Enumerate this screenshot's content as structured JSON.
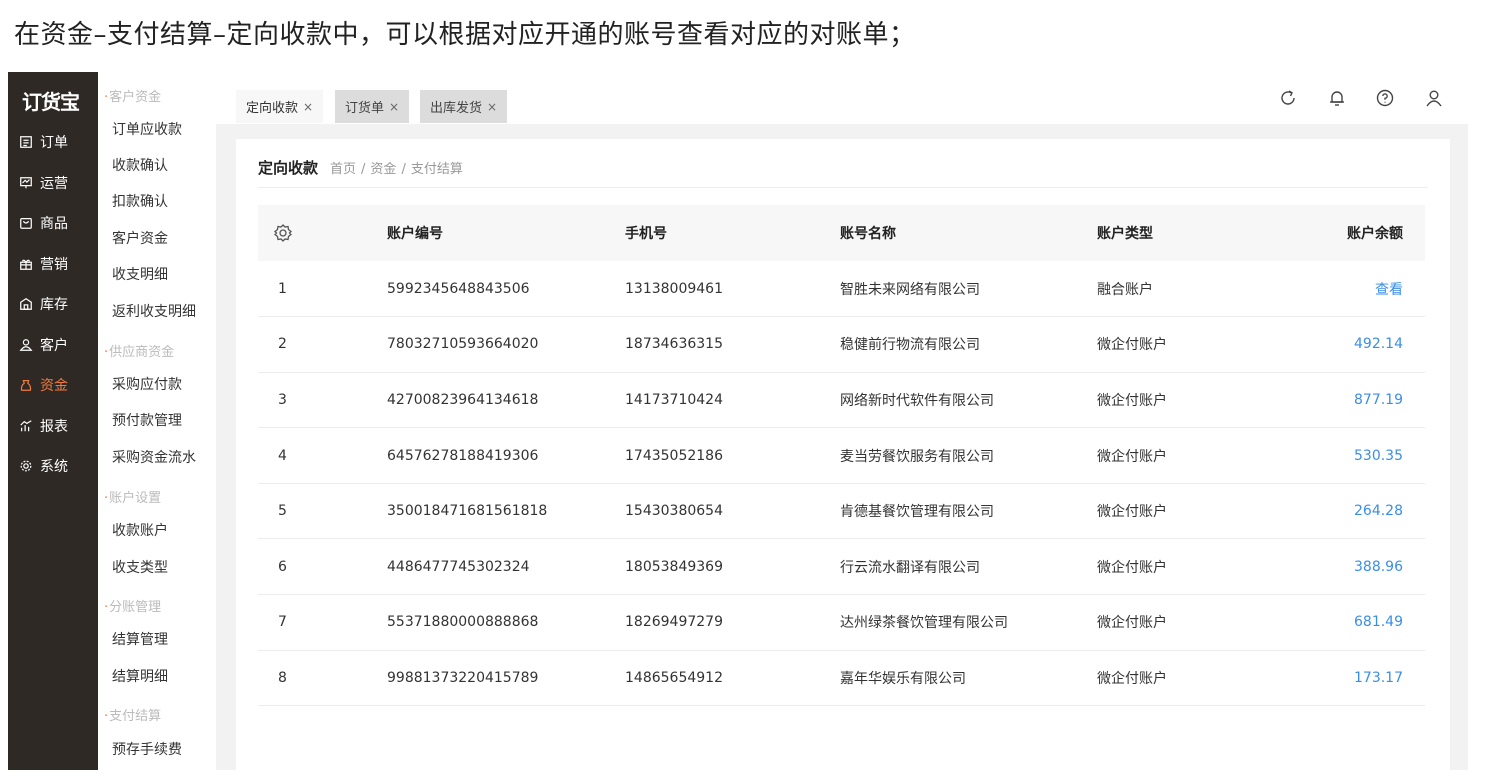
{
  "caption": "在资金–支付结算–定向收款中，可以根据对应开通的账号查看对应的对账单；",
  "logo": "订货宝",
  "nav": [
    {
      "label": "订单",
      "icon": "list-icon"
    },
    {
      "label": "运营",
      "icon": "chart-board-icon"
    },
    {
      "label": "商品",
      "icon": "bag-icon"
    },
    {
      "label": "营销",
      "icon": "gift-icon"
    },
    {
      "label": "库存",
      "icon": "warehouse-icon"
    },
    {
      "label": "客户",
      "icon": "user-icon"
    },
    {
      "label": "资金",
      "icon": "money-bag-icon",
      "active": true
    },
    {
      "label": "报表",
      "icon": "bar-chart-icon"
    },
    {
      "label": "系统",
      "icon": "gear-icon"
    }
  ],
  "submenu": {
    "groups": [
      {
        "title": "客户资金",
        "items": [
          "订单应收款",
          "收款确认",
          "扣款确认",
          "客户资金",
          "收支明细",
          "返利收支明细"
        ]
      },
      {
        "title": "供应商资金",
        "items": [
          "采购应付款",
          "预付款管理",
          "采购资金流水"
        ]
      },
      {
        "title": "账户设置",
        "items": [
          "收款账户",
          "收支类型"
        ]
      },
      {
        "title": "分账管理",
        "items": [
          "结算管理",
          "结算明细"
        ]
      },
      {
        "title": "支付结算",
        "items": [
          "预存手续费"
        ]
      }
    ]
  },
  "tabs": [
    {
      "label": "定向收款",
      "close": "×"
    },
    {
      "label": "订货单",
      "close": "×"
    },
    {
      "label": "出库发货",
      "close": "×"
    }
  ],
  "top_icons": [
    "refresh-icon",
    "bell-icon",
    "help-icon",
    "user-icon"
  ],
  "page": {
    "title": "定向收款",
    "breadcrumb": [
      "首页",
      "资金",
      "支付结算"
    ],
    "breadcrumb_sep": "/"
  },
  "table": {
    "settings_icon": "gear-icon",
    "headers": [
      "账户编号",
      "手机号",
      "账号名称",
      "账户类型",
      "账户余额"
    ],
    "rows": [
      {
        "index": "1",
        "account_no": "5992345648843506",
        "phone": "13138009461",
        "name": "智胜未来网络有限公司",
        "type": "融合账户",
        "balance": "查看"
      },
      {
        "index": "2",
        "account_no": "78032710593664020",
        "phone": "18734636315",
        "name": "稳健前行物流有限公司",
        "type": "微企付账户",
        "balance": "492.14"
      },
      {
        "index": "3",
        "account_no": "42700823964134618",
        "phone": "14173710424",
        "name": "网络新时代软件有限公司",
        "type": "微企付账户",
        "balance": "877.19"
      },
      {
        "index": "4",
        "account_no": "64576278188419306",
        "phone": "17435052186",
        "name": "麦当劳餐饮服务有限公司",
        "type": "微企付账户",
        "balance": "530.35"
      },
      {
        "index": "5",
        "account_no": "350018471681561818",
        "phone": "15430380654",
        "name": "肯德基餐饮管理有限公司",
        "type": "微企付账户",
        "balance": "264.28"
      },
      {
        "index": "6",
        "account_no": "4486477745302324",
        "phone": "18053849369",
        "name": "行云流水翻译有限公司",
        "type": "微企付账户",
        "balance": "388.96"
      },
      {
        "index": "7",
        "account_no": "55371880000888868",
        "phone": "18269497279",
        "name": "达州绿茶餐饮管理有限公司",
        "type": "微企付账户",
        "balance": "681.49"
      },
      {
        "index": "8",
        "account_no": "99881373220415789",
        "phone": "14865654912",
        "name": "嘉年华娱乐有限公司",
        "type": "微企付账户",
        "balance": "173.17"
      }
    ]
  },
  "colors": {
    "sidebar_bg": "#2f2925",
    "active_accent": "#f07a3c",
    "link": "#3a8ee6"
  }
}
